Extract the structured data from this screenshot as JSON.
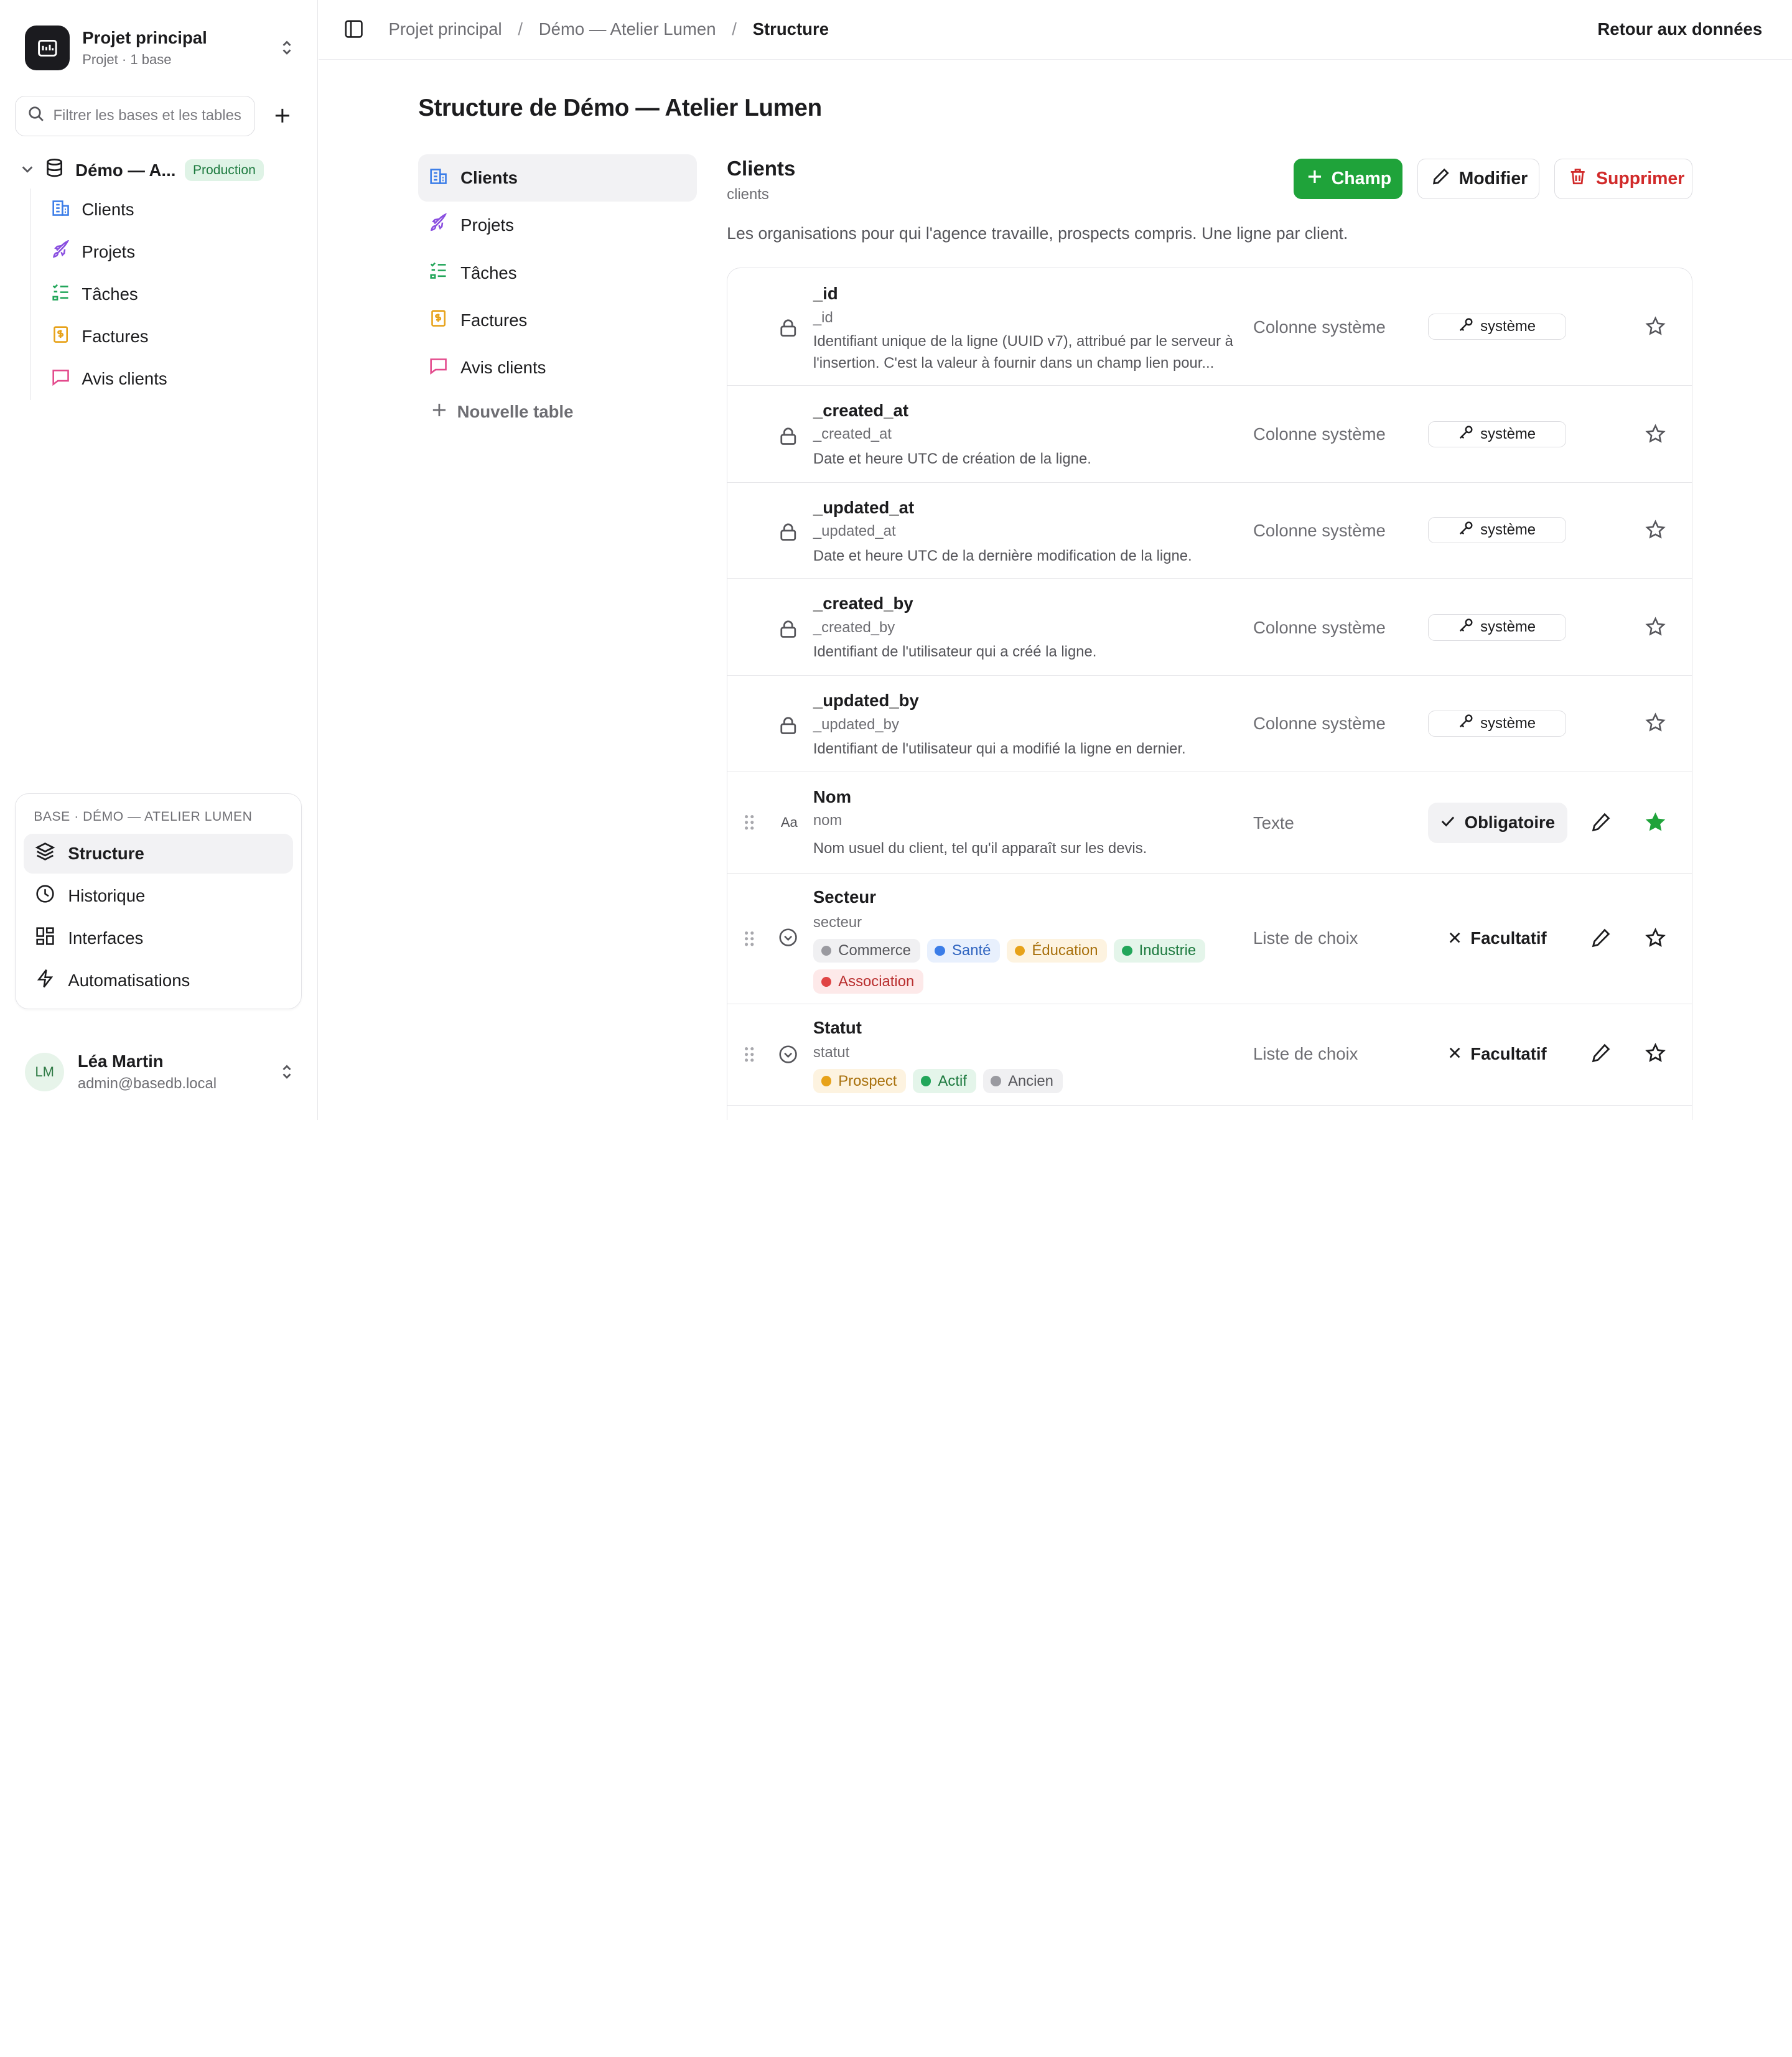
{
  "project": {
    "name": "Projet principal",
    "subtitle": "Projet · 1 base",
    "logo_icon": "database-frame-icon"
  },
  "sidebar": {
    "filter_placeholder": "Filtrer les bases et les tables",
    "database": {
      "name": "Démo — A...",
      "badge": "Production"
    },
    "tables": [
      {
        "label": "Clients",
        "icon": "building-icon",
        "color": "#3b7de8"
      },
      {
        "label": "Projets",
        "icon": "rocket-icon",
        "color": "#8a4fe0"
      },
      {
        "label": "Tâches",
        "icon": "checklist-icon",
        "color": "#22a65a"
      },
      {
        "label": "Factures",
        "icon": "invoice-icon",
        "color": "#e7a21a"
      },
      {
        "label": "Avis clients",
        "icon": "message-icon",
        "color": "#e34a8c"
      }
    ],
    "base_section": {
      "title": "BASE · DÉMO — ATELIER LUMEN",
      "items": [
        {
          "label": "Structure",
          "icon": "layers-icon",
          "active": true
        },
        {
          "label": "Historique",
          "icon": "clock-icon"
        },
        {
          "label": "Interfaces",
          "icon": "grid-icon"
        },
        {
          "label": "Automatisations",
          "icon": "bolt-icon"
        }
      ]
    },
    "user": {
      "initials": "LM",
      "name": "Léa Martin",
      "email": "admin@basedb.local"
    }
  },
  "topbar": {
    "breadcrumb": [
      "Projet principal",
      "Démo — Atelier Lumen",
      "Structure"
    ],
    "back_label": "Retour aux données"
  },
  "main": {
    "title": "Structure de Démo — Atelier Lumen",
    "tables": [
      "Clients",
      "Projets",
      "Tâches",
      "Factures",
      "Avis clients"
    ],
    "new_table_label": "Nouvelle table",
    "table": {
      "name": "Clients",
      "slug": "clients",
      "description": "Les organisations pour qui l'agence travaille, prospects compris. Une ligne par client.",
      "buttons": {
        "add_field": "Champ",
        "edit": "Modifier",
        "delete": "Supprimer"
      }
    },
    "fields": [
      {
        "name": "_id",
        "slug": "_id",
        "desc": "Identifiant unique de la ligne (UUID v7), attribué par le serveur à l'insertion. C'est la valeur à fournir dans un champ lien pour...",
        "type": "Colonne système",
        "badge": "système"
      },
      {
        "name": "_created_at",
        "slug": "_created_at",
        "desc": "Date et heure UTC de création de la ligne.",
        "type": "Colonne système",
        "badge": "système"
      },
      {
        "name": "_updated_at",
        "slug": "_updated_at",
        "desc": "Date et heure UTC de la dernière modification de la ligne.",
        "type": "Colonne système",
        "badge": "système"
      },
      {
        "name": "_created_by",
        "slug": "_created_by",
        "desc": "Identifiant de l'utilisateur qui a créé la ligne.",
        "type": "Colonne système",
        "badge": "système"
      },
      {
        "name": "_updated_by",
        "slug": "_updated_by",
        "desc": "Identifiant de l'utilisateur qui a modifié la ligne en dernier.",
        "type": "Colonne système",
        "badge": "système"
      },
      {
        "name": "Nom",
        "slug": "nom",
        "desc": "Nom usuel du client, tel qu'il apparaît sur les devis.",
        "type": "Texte",
        "badge": "Obligatoire",
        "type_icon": "Aa"
      },
      {
        "name": "Secteur",
        "slug": "secteur",
        "type": "Liste de choix",
        "badge": "Facultatif",
        "options": [
          {
            "label": "Commerce",
            "color": "#9a9aa0"
          },
          {
            "label": "Santé",
            "color": "#3b7de8"
          },
          {
            "label": "Éducation",
            "color": "#e7a21a"
          },
          {
            "label": "Industrie",
            "color": "#22a65a"
          },
          {
            "label": "Association",
            "color": "#e04444"
          }
        ]
      },
      {
        "name": "Statut",
        "slug": "statut",
        "type": "Liste de choix",
        "badge": "Facultatif",
        "options": [
          {
            "label": "Prospect",
            "color": "#e7a21a"
          },
          {
            "label": "Actif",
            "color": "#22a65a"
          },
          {
            "label": "Ancien",
            "color": "#9a9aa0"
          }
        ]
      }
    ]
  }
}
